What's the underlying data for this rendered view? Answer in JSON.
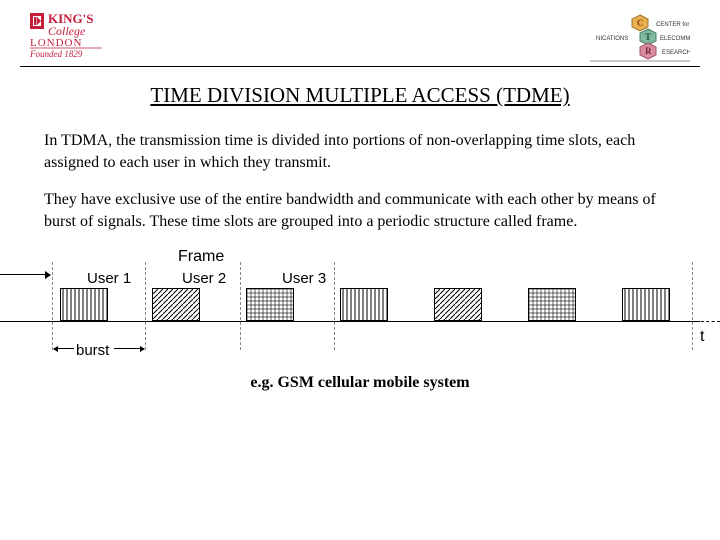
{
  "header": {
    "left_logo": {
      "line1": "KING'S",
      "line2": "College",
      "line3": "LONDON",
      "line4": "Founded 1829"
    },
    "right_logo": {
      "center": "CENTER for",
      "line_a": "NICATIONS",
      "line_b": "ELECOMM",
      "line_c": "ESEARCH",
      "letters": [
        "C",
        "T",
        "R"
      ]
    }
  },
  "title": "TIME DIVISION MULTIPLE ACCESS (TDME)",
  "paragraphs": {
    "p1": "In TDMA, the transmission time is divided into portions of non-overlapping time slots, each assigned to each user in which they transmit.",
    "p2": "They have exclusive use of the entire bandwidth and communicate with each other by means of burst of signals.  These time slots are grouped into a periodic structure called frame."
  },
  "diagram": {
    "frame_label": "Frame",
    "users": [
      "User 1",
      "User 2",
      "User 3"
    ],
    "axis_label": "t",
    "burst_label": "burst",
    "slot_count": 7
  },
  "caption": "e.g. GSM cellular mobile system"
}
